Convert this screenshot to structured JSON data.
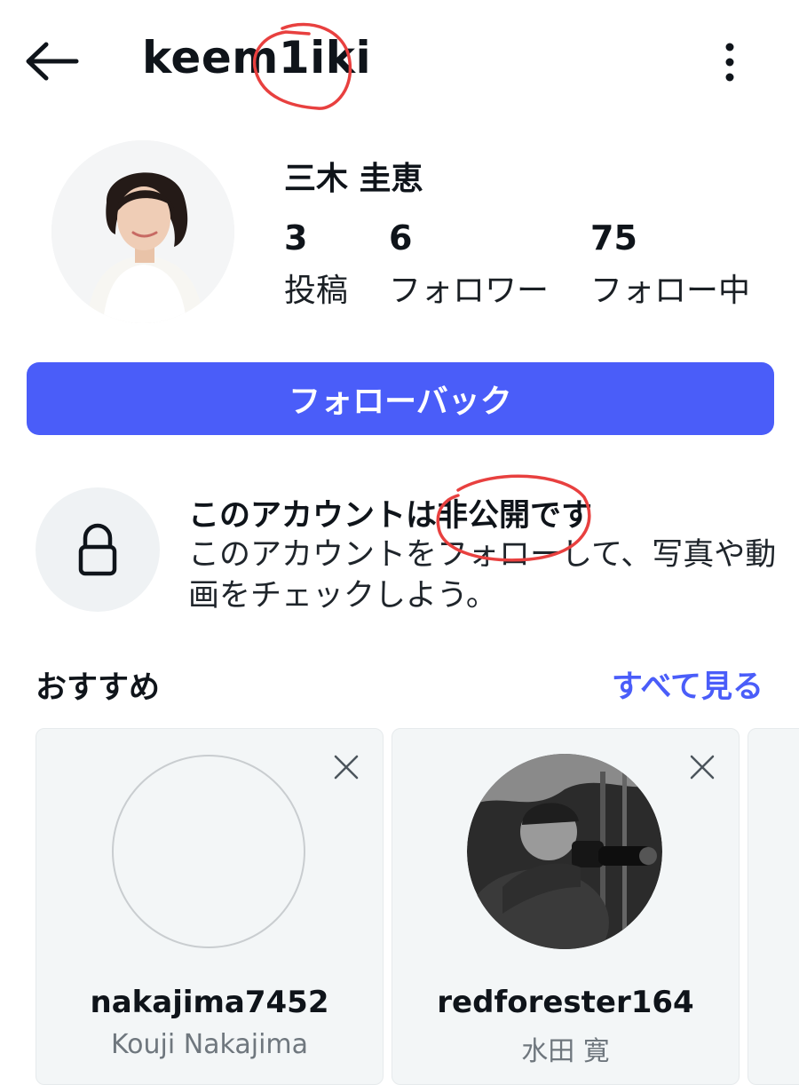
{
  "header": {
    "username": "keem1iki",
    "back_icon": "arrow-left-icon",
    "more_icon": "vertical-dots-icon"
  },
  "profile": {
    "display_name": "三木 圭恵",
    "stats": [
      {
        "value": "3",
        "label": "投稿"
      },
      {
        "value": "6",
        "label": "フォロワー"
      },
      {
        "value": "75",
        "label": "フォロー中"
      }
    ],
    "follow_back_label": "フォローバック"
  },
  "private_notice": {
    "icon": "lock-icon",
    "title": "このアカウントは非公開です",
    "description": "このアカウントをフォローして、写真や動画をチェックしよう。"
  },
  "recommended": {
    "title": "おすすめ",
    "see_all_label": "すべて見る",
    "cards": [
      {
        "username": "nakajima7452",
        "full_name": "Kouji Nakajima"
      },
      {
        "username": "redforester164",
        "full_name": "水田 寛"
      }
    ]
  },
  "colors": {
    "accent": "#4a5df9",
    "annotation": "#e8403f",
    "card_bg": "#f3f6f7"
  }
}
